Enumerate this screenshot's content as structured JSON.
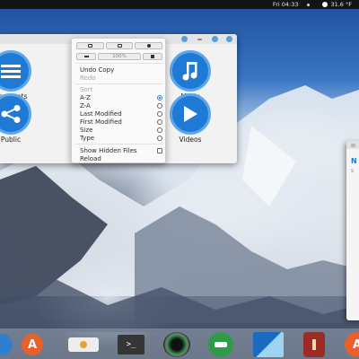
{
  "top_panel": {
    "clock": "Fri 04:33",
    "weather": "31.6 °F"
  },
  "file_manager": {
    "folders": [
      {
        "label": "ocuments",
        "icon": "document-icon"
      },
      {
        "label": "Public",
        "icon": "share-icon"
      },
      {
        "label": "Music",
        "icon": "music-note-icon"
      },
      {
        "label": "Videos",
        "icon": "play-icon"
      }
    ]
  },
  "context_menu": {
    "zoom": "100%",
    "undo": "Undo Copy",
    "redo": "Redo",
    "sort_heading": "Sort",
    "sort_options": [
      "A-Z",
      "Z-A",
      "Last Modified",
      "First Modified",
      "Size",
      "Type"
    ],
    "sort_selected": "A-Z",
    "show_hidden": "Show Hidden Files",
    "reload": "Reload"
  },
  "side_window": {
    "letter": "N",
    "sub": "S"
  },
  "colors": {
    "accent": "#2f7fd0",
    "folder_blue": "#1f7ad6"
  },
  "dock": {
    "items": [
      "files-icon",
      "app-center-icon",
      "toggle-icon",
      "terminal-icon",
      "camera-lens-icon",
      "mail-icon",
      "paper-plane-icon",
      "wine-icon",
      "app-center-icon"
    ]
  }
}
